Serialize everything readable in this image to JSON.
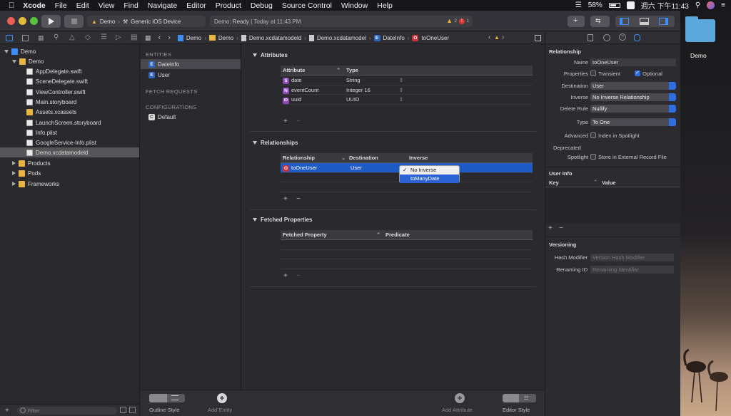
{
  "menubar": {
    "apple_icon": "apple-icon",
    "app": "Xcode",
    "items": [
      "File",
      "Edit",
      "View",
      "Find",
      "Navigate",
      "Editor",
      "Product",
      "Debug",
      "Source Control",
      "Window",
      "Help"
    ],
    "battery": "58%",
    "clock": "週六 下午11:43"
  },
  "toolbar": {
    "scheme": "Demo",
    "device": "Generic iOS Device",
    "status_prefix": "Demo:",
    "status_state": "Ready",
    "status_time": "| Today at 11:43 PM",
    "warnings": "2",
    "errors": "1"
  },
  "navigator": {
    "tree": [
      {
        "label": "Demo",
        "icon": "blueprint",
        "level": 0,
        "disclosure": "open"
      },
      {
        "label": "Demo",
        "icon": "folder",
        "level": 1,
        "disclosure": "open"
      },
      {
        "label": "AppDelegate.swift",
        "icon": "swift",
        "level": 2
      },
      {
        "label": "SceneDelegate.swift",
        "icon": "swift",
        "level": 2
      },
      {
        "label": "ViewController.swift",
        "icon": "swift",
        "level": 2
      },
      {
        "label": "Main.storyboard",
        "icon": "storyboard",
        "level": 2
      },
      {
        "label": "Assets.xcassets",
        "icon": "folder",
        "level": 2
      },
      {
        "label": "LaunchScreen.storyboard",
        "icon": "storyboard",
        "level": 2
      },
      {
        "label": "Info.plist",
        "icon": "plist",
        "level": 2
      },
      {
        "label": "GoogleService-Info.plist",
        "icon": "plist",
        "level": 2
      },
      {
        "label": "Demo.xcdatamodeld",
        "icon": "datamodel",
        "level": 2,
        "selected": true
      },
      {
        "label": "Products",
        "icon": "folder",
        "level": 1,
        "disclosure": "closed"
      },
      {
        "label": "Pods",
        "icon": "folder",
        "level": 1,
        "disclosure": "closed"
      },
      {
        "label": "Frameworks",
        "icon": "folder",
        "level": 1,
        "disclosure": "closed"
      }
    ],
    "filter_placeholder": "Filter"
  },
  "jumpbar": {
    "crumbs": [
      "Demo",
      "Demo",
      "Demo.xcdatamodeld",
      "Demo.xcdatamodel",
      "DateInfo",
      "toOneUser"
    ]
  },
  "entity_list": {
    "entities_header": "ENTITIES",
    "entities": [
      "DateInfo",
      "User"
    ],
    "fetch_header": "FETCH REQUESTS",
    "config_header": "CONFIGURATIONS",
    "configs": [
      "Default"
    ]
  },
  "editor": {
    "attributes": {
      "title": "Attributes",
      "col_attr": "Attribute",
      "col_type": "Type",
      "rows": [
        {
          "badge": "S",
          "name": "date",
          "type": "String"
        },
        {
          "badge": "N",
          "name": "eventCount",
          "type": "Integer 16"
        },
        {
          "badge": "ID",
          "name": "uuid",
          "type": "UUID"
        }
      ]
    },
    "relationships": {
      "title": "Relationships",
      "col_rel": "Relationship",
      "col_dest": "Destination",
      "col_inv": "Inverse",
      "rows": [
        {
          "badge": "O",
          "name": "toOneUser",
          "dest": "User"
        }
      ]
    },
    "inverse_popup": {
      "checked": "No Inverse",
      "other": "toManyDate"
    },
    "fetched": {
      "title": "Fetched Properties",
      "col_prop": "Fetched Property",
      "col_pred": "Predicate"
    }
  },
  "bottom": {
    "outline_style": "Outline Style",
    "add_entity": "Add Entity",
    "add_attribute": "Add Attribute",
    "editor_style": "Editor Style"
  },
  "inspector": {
    "relationship_header": "Relationship",
    "name_label": "Name",
    "name_value": "toOneUser",
    "properties_label": "Properties",
    "transient": "Transient",
    "optional": "Optional",
    "destination_label": "Destination",
    "destination_value": "User",
    "inverse_label": "Inverse",
    "inverse_value": "No Inverse Relationship",
    "delete_rule_label": "Delete Rule",
    "delete_rule_value": "Nullify",
    "type_label": "Type",
    "type_value": "To One",
    "advanced_label": "Advanced",
    "index_spotlight": "Index in Spotlight",
    "deprecated_header": "Deprecated",
    "spotlight_label": "Spotlight",
    "store_external": "Store in External Record File",
    "user_info_header": "User Info",
    "key_col": "Key",
    "value_col": "Value",
    "versioning_header": "Versioning",
    "hash_label": "Hash Modifier",
    "hash_placeholder": "Version Hash Modifier",
    "renaming_label": "Renaming ID",
    "renaming_placeholder": "Renaming Identifier"
  },
  "desktop": {
    "folder_label": "Demo"
  }
}
